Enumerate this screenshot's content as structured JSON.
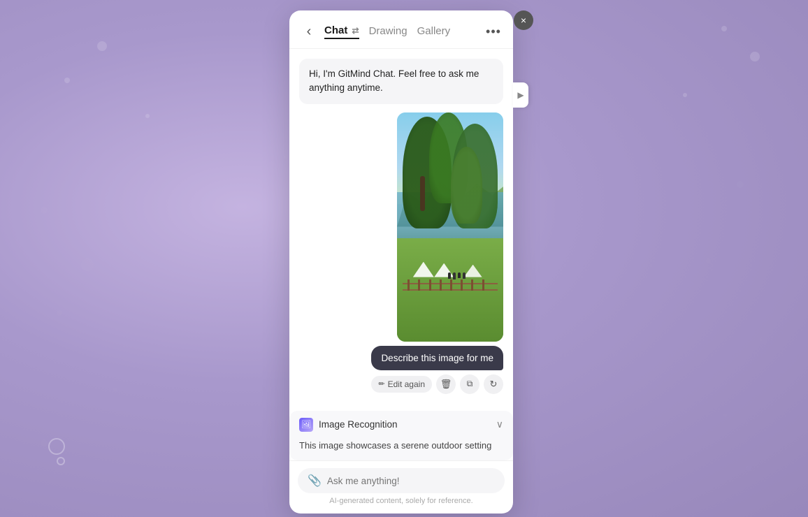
{
  "background": {
    "color_start": "#b8a8d8",
    "color_end": "#9888bb"
  },
  "close_button": {
    "label": "×"
  },
  "expand_arrow": {
    "icon": "▶"
  },
  "header": {
    "back_icon": "‹",
    "tabs": [
      {
        "id": "chat",
        "label": "Chat",
        "active": true
      },
      {
        "id": "drawing",
        "label": "Drawing",
        "active": false
      },
      {
        "id": "gallery",
        "label": "Gallery",
        "active": false
      }
    ],
    "swap_icon": "⇄",
    "more_icon": "•••"
  },
  "bot_message": {
    "text": "Hi, I'm GitMind Chat. Feel free to ask me anything anytime."
  },
  "user_message": {
    "text": "Describe this image for me"
  },
  "action_bar": {
    "edit_again_label": "Edit again",
    "edit_icon": "✏",
    "delete_icon": "🗑",
    "copy_icon": "⧉",
    "refresh_icon": "↻"
  },
  "recognition": {
    "title": "Image Recognition",
    "icon": "🖼",
    "content": "This image showcases a serene outdoor setting",
    "chevron": "∨"
  },
  "input": {
    "placeholder": "Ask me anything!",
    "disclaimer": "AI-generated content, solely for reference."
  }
}
